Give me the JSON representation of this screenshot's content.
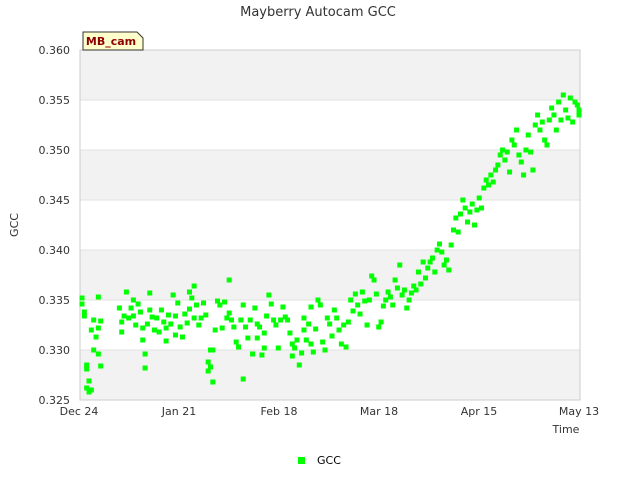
{
  "chart_data": {
    "type": "scatter",
    "title": "Mayberry Autocam GCC",
    "xlabel": "Time",
    "ylabel": "GCC",
    "tag": "MB_cam",
    "x_range": [
      "Dec 24",
      "May 13"
    ],
    "ylim": [
      0.325,
      0.36
    ],
    "y_ticks": [
      "0.325",
      "0.330",
      "0.335",
      "0.340",
      "0.345",
      "0.350",
      "0.355",
      "0.360"
    ],
    "x_ticks": [
      "Dec 24",
      "Jan 21",
      "Feb 18",
      "Mar 18",
      "Apr 15",
      "May 13"
    ],
    "grid": "horizontal bands",
    "legend_position": "bottom",
    "series": [
      {
        "name": "GCC",
        "color": "#00ff00",
        "x_days_note": "days after Dec 24",
        "points": [
          [
            0,
            0.3352
          ],
          [
            0,
            0.3346
          ],
          [
            1,
            0.3338
          ],
          [
            1,
            0.3334
          ],
          [
            2,
            0.3285
          ],
          [
            2,
            0.3281
          ],
          [
            2,
            0.3262
          ],
          [
            3,
            0.3269
          ],
          [
            3,
            0.3258
          ],
          [
            4,
            0.326
          ],
          [
            4,
            0.332
          ],
          [
            5,
            0.333
          ],
          [
            5,
            0.33
          ],
          [
            6,
            0.3313
          ],
          [
            7,
            0.3296
          ],
          [
            7,
            0.3322
          ],
          [
            7,
            0.3353
          ],
          [
            8,
            0.3329
          ],
          [
            8,
            0.3284
          ],
          [
            16,
            0.3342
          ],
          [
            17,
            0.3318
          ],
          [
            17,
            0.3328
          ],
          [
            18,
            0.3334
          ],
          [
            19,
            0.3358
          ],
          [
            20,
            0.3332
          ],
          [
            21,
            0.3342
          ],
          [
            22,
            0.335
          ],
          [
            22,
            0.3334
          ],
          [
            23,
            0.3325
          ],
          [
            24,
            0.3346
          ],
          [
            25,
            0.3338
          ],
          [
            26,
            0.3322
          ],
          [
            26,
            0.331
          ],
          [
            27,
            0.3296
          ],
          [
            27,
            0.3282
          ],
          [
            28,
            0.3326
          ],
          [
            29,
            0.3357
          ],
          [
            29,
            0.334
          ],
          [
            30,
            0.3333
          ],
          [
            31,
            0.332
          ],
          [
            32,
            0.3332
          ],
          [
            33,
            0.3318
          ],
          [
            34,
            0.334
          ],
          [
            35,
            0.3328
          ],
          [
            36,
            0.3322
          ],
          [
            36,
            0.3309
          ],
          [
            37,
            0.3335
          ],
          [
            38,
            0.3326
          ],
          [
            39,
            0.3355
          ],
          [
            40,
            0.3315
          ],
          [
            40,
            0.3334
          ],
          [
            41,
            0.3347
          ],
          [
            42,
            0.3323
          ],
          [
            43,
            0.3313
          ],
          [
            44,
            0.3336
          ],
          [
            45,
            0.3327
          ],
          [
            46,
            0.3358
          ],
          [
            46,
            0.3341
          ],
          [
            47,
            0.3352
          ],
          [
            48,
            0.3364
          ],
          [
            48,
            0.3332
          ],
          [
            49,
            0.3345
          ],
          [
            50,
            0.3325
          ],
          [
            51,
            0.3332
          ],
          [
            52,
            0.3347
          ],
          [
            53,
            0.3335
          ],
          [
            54,
            0.3288
          ],
          [
            54,
            0.3279
          ],
          [
            55,
            0.3283
          ],
          [
            55,
            0.33
          ],
          [
            56,
            0.3268
          ],
          [
            56,
            0.33
          ],
          [
            57,
            0.332
          ],
          [
            58,
            0.3349
          ],
          [
            59,
            0.3345
          ],
          [
            60,
            0.3322
          ],
          [
            61,
            0.3348
          ],
          [
            62,
            0.3332
          ],
          [
            63,
            0.337
          ],
          [
            63,
            0.3337
          ],
          [
            64,
            0.333
          ],
          [
            65,
            0.3323
          ],
          [
            66,
            0.3308
          ],
          [
            67,
            0.3303
          ],
          [
            68,
            0.333
          ],
          [
            69,
            0.3345
          ],
          [
            69,
            0.3271
          ],
          [
            70,
            0.3323
          ],
          [
            71,
            0.3312
          ],
          [
            72,
            0.333
          ],
          [
            73,
            0.3296
          ],
          [
            74,
            0.3342
          ],
          [
            75,
            0.3312
          ],
          [
            75,
            0.3326
          ],
          [
            76,
            0.3323
          ],
          [
            77,
            0.3295
          ],
          [
            78,
            0.3302
          ],
          [
            78,
            0.3317
          ],
          [
            79,
            0.3334
          ],
          [
            80,
            0.3355
          ],
          [
            81,
            0.3346
          ],
          [
            82,
            0.333
          ],
          [
            83,
            0.3325
          ],
          [
            84,
            0.3302
          ],
          [
            85,
            0.333
          ],
          [
            86,
            0.3343
          ],
          [
            87,
            0.3333
          ],
          [
            88,
            0.333
          ],
          [
            89,
            0.3317
          ],
          [
            90,
            0.3306
          ],
          [
            90,
            0.3294
          ],
          [
            91,
            0.3302
          ],
          [
            92,
            0.331
          ],
          [
            93,
            0.3285
          ],
          [
            94,
            0.3297
          ],
          [
            95,
            0.332
          ],
          [
            95,
            0.3332
          ],
          [
            96,
            0.331
          ],
          [
            97,
            0.3326
          ],
          [
            98,
            0.3343
          ],
          [
            98,
            0.3306
          ],
          [
            99,
            0.3298
          ],
          [
            100,
            0.3321
          ],
          [
            101,
            0.335
          ],
          [
            102,
            0.3345
          ],
          [
            103,
            0.3308
          ],
          [
            104,
            0.33
          ],
          [
            105,
            0.3332
          ],
          [
            106,
            0.3326
          ],
          [
            107,
            0.3314
          ],
          [
            108,
            0.334
          ],
          [
            109,
            0.3332
          ],
          [
            110,
            0.332
          ],
          [
            111,
            0.3306
          ],
          [
            112,
            0.3325
          ],
          [
            113,
            0.3303
          ],
          [
            114,
            0.3328
          ],
          [
            115,
            0.335
          ],
          [
            116,
            0.3339
          ],
          [
            117,
            0.3356
          ],
          [
            118,
            0.3345
          ],
          [
            119,
            0.3336
          ],
          [
            120,
            0.3358
          ],
          [
            121,
            0.3349
          ],
          [
            122,
            0.3325
          ],
          [
            123,
            0.335
          ],
          [
            124,
            0.3374
          ],
          [
            125,
            0.337
          ],
          [
            126,
            0.3356
          ],
          [
            127,
            0.3323
          ],
          [
            128,
            0.3328
          ],
          [
            129,
            0.3344
          ],
          [
            130,
            0.335
          ],
          [
            131,
            0.3358
          ],
          [
            132,
            0.3353
          ],
          [
            133,
            0.3345
          ],
          [
            134,
            0.337
          ],
          [
            135,
            0.3362
          ],
          [
            136,
            0.3385
          ],
          [
            137,
            0.3355
          ],
          [
            138,
            0.336
          ],
          [
            139,
            0.3342
          ],
          [
            140,
            0.335
          ],
          [
            141,
            0.3357
          ],
          [
            142,
            0.3364
          ],
          [
            143,
            0.336
          ],
          [
            144,
            0.3378
          ],
          [
            145,
            0.3366
          ],
          [
            146,
            0.3388
          ],
          [
            147,
            0.3372
          ],
          [
            148,
            0.3382
          ],
          [
            149,
            0.3388
          ],
          [
            150,
            0.3392
          ],
          [
            151,
            0.3378
          ],
          [
            152,
            0.34
          ],
          [
            153,
            0.3406
          ],
          [
            154,
            0.3398
          ],
          [
            155,
            0.3385
          ],
          [
            156,
            0.339
          ],
          [
            157,
            0.338
          ],
          [
            158,
            0.3405
          ],
          [
            159,
            0.342
          ],
          [
            160,
            0.3432
          ],
          [
            161,
            0.3418
          ],
          [
            162,
            0.3436
          ],
          [
            163,
            0.345
          ],
          [
            164,
            0.3442
          ],
          [
            165,
            0.3428
          ],
          [
            166,
            0.3438
          ],
          [
            167,
            0.3446
          ],
          [
            168,
            0.3425
          ],
          [
            169,
            0.344
          ],
          [
            170,
            0.3452
          ],
          [
            171,
            0.3442
          ],
          [
            172,
            0.3462
          ],
          [
            173,
            0.347
          ],
          [
            174,
            0.3465
          ],
          [
            175,
            0.3475
          ],
          [
            176,
            0.3468
          ],
          [
            177,
            0.348
          ],
          [
            178,
            0.3485
          ],
          [
            179,
            0.3495
          ],
          [
            180,
            0.35
          ],
          [
            181,
            0.349
          ],
          [
            182,
            0.3498
          ],
          [
            183,
            0.3478
          ],
          [
            184,
            0.351
          ],
          [
            185,
            0.3505
          ],
          [
            186,
            0.352
          ],
          [
            187,
            0.3495
          ],
          [
            188,
            0.3488
          ],
          [
            189,
            0.3475
          ],
          [
            190,
            0.35
          ],
          [
            191,
            0.3515
          ],
          [
            192,
            0.3498
          ],
          [
            193,
            0.348
          ],
          [
            194,
            0.3525
          ],
          [
            195,
            0.3535
          ],
          [
            196,
            0.352
          ],
          [
            197,
            0.3528
          ],
          [
            198,
            0.351
          ],
          [
            199,
            0.3505
          ],
          [
            200,
            0.353
          ],
          [
            201,
            0.3542
          ],
          [
            202,
            0.3535
          ],
          [
            203,
            0.352
          ],
          [
            204,
            0.3548
          ],
          [
            205,
            0.353
          ],
          [
            206,
            0.3555
          ],
          [
            207,
            0.354
          ],
          [
            208,
            0.3532
          ],
          [
            209,
            0.3552
          ],
          [
            210,
            0.3528
          ],
          [
            211,
            0.3548
          ],
          [
            212,
            0.3545
          ],
          [
            213,
            0.354
          ],
          [
            214,
            0.3535
          ]
        ]
      }
    ]
  }
}
